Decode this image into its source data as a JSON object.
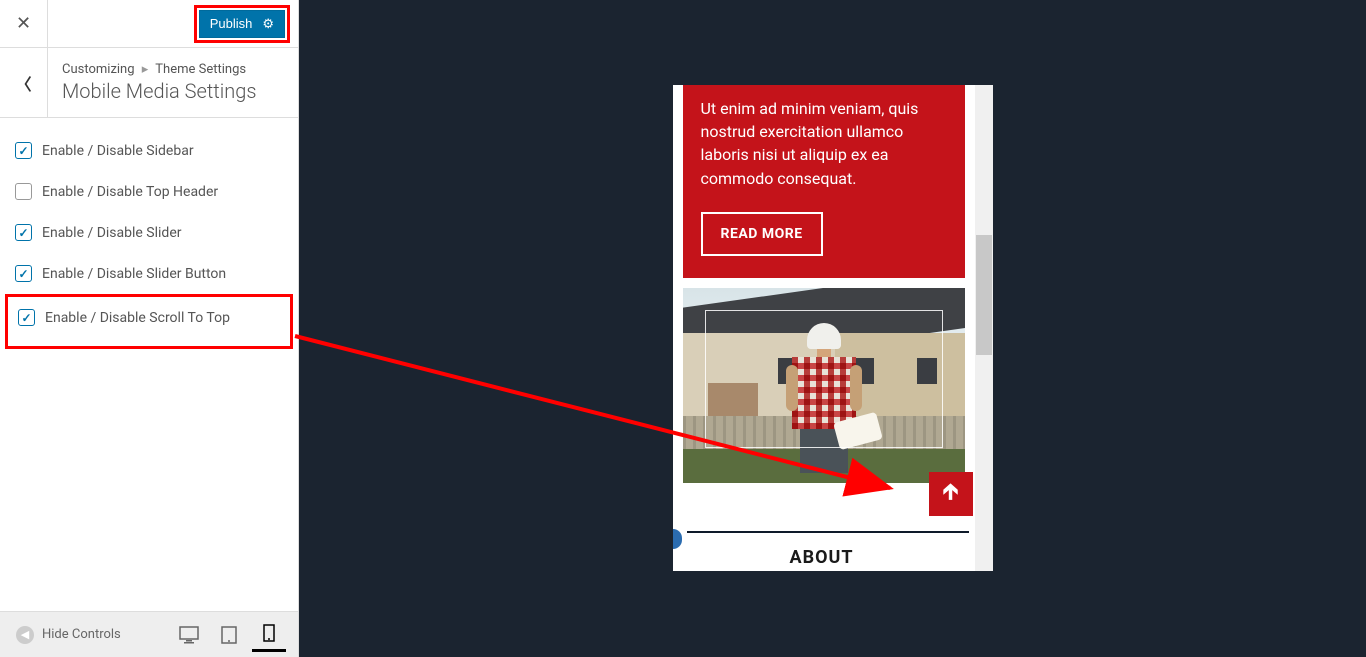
{
  "header": {
    "publish_label": "Publish"
  },
  "section": {
    "breadcrumb_root": "Customizing",
    "breadcrumb_leaf": "Theme Settings",
    "title": "Mobile Media Settings"
  },
  "controls": {
    "sidebar": {
      "label": "Enable / Disable Sidebar",
      "checked": true
    },
    "top_header": {
      "label": "Enable / Disable Top Header",
      "checked": false
    },
    "slider": {
      "label": "Enable / Disable Slider",
      "checked": true
    },
    "slider_button": {
      "label": "Enable / Disable Slider Button",
      "checked": true
    },
    "scroll_to_top": {
      "label": "Enable / Disable Scroll To Top",
      "checked": true
    }
  },
  "footer": {
    "hide_controls_label": "Hide Controls"
  },
  "preview": {
    "card_text": "Ut enim ad minim veniam, quis nostrud exercitation ullamco laboris nisi ut aliquip ex ea commodo consequat.",
    "read_more_label": "READ MORE",
    "about_heading": "ABOUT"
  }
}
